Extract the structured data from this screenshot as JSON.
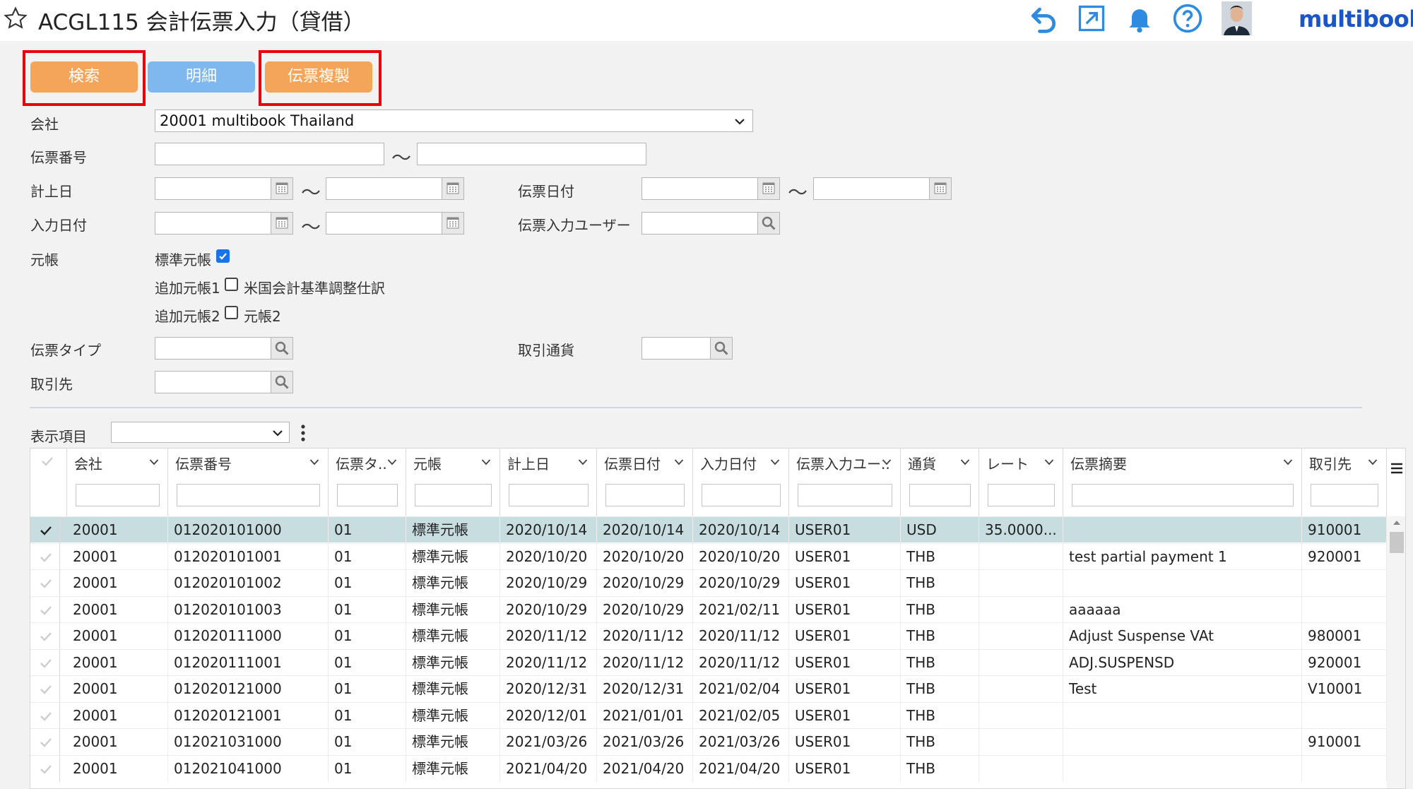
{
  "header": {
    "title": "ACGL115 会計伝票入力（貸借）",
    "logo": "multibook",
    "icons": [
      "star-icon",
      "undo-icon",
      "external-link-icon",
      "bell-icon",
      "help-icon",
      "avatar"
    ]
  },
  "toolbar": {
    "search_label": "検索",
    "detail_label": "明細",
    "copy_label": "伝票複製"
  },
  "form": {
    "company_label": "会社",
    "company_value": "20001 multibook Thailand",
    "voucher_no_label": "伝票番号",
    "posting_date_label": "計上日",
    "voucher_date_label": "伝票日付",
    "input_date_label": "入力日付",
    "input_user_label": "伝票入力ユーザー",
    "ledger_label": "元帳",
    "ledger_standard_label": "標準元帳",
    "ledger_add1_label": "追加元帳1",
    "ledger_add1_option": "米国会計基準調整仕訳",
    "ledger_add2_label": "追加元帳2",
    "ledger_add2_option": "元帳2",
    "voucher_type_label": "伝票タイプ",
    "currency_label": "取引通貨",
    "partner_label": "取引先",
    "range_sep": "〜"
  },
  "display": {
    "label": "表示項目"
  },
  "colors": {
    "orange": "#f5a55a",
    "blue": "#7fb7ef",
    "highlight": "#e8000b",
    "brand": "#1c56c6",
    "selected_row": "#c8dde0"
  },
  "grid": {
    "columns": [
      "会社",
      "伝票番号",
      "伝票タ..",
      "元帳",
      "計上日",
      "伝票日付",
      "入力日付",
      "伝票入力ユー..",
      "通貨",
      "レート",
      "伝票摘要",
      "取引先"
    ],
    "rows": [
      [
        "20001",
        "012020101000",
        "01",
        "標準元帳",
        "2020/10/14",
        "2020/10/14",
        "2020/10/14",
        "USER01",
        "USD",
        "35.0000...",
        "",
        "910001"
      ],
      [
        "20001",
        "012020101001",
        "01",
        "標準元帳",
        "2020/10/20",
        "2020/10/20",
        "2020/10/20",
        "USER01",
        "THB",
        "",
        "test partial payment 1",
        "920001"
      ],
      [
        "20001",
        "012020101002",
        "01",
        "標準元帳",
        "2020/10/29",
        "2020/10/29",
        "2020/10/29",
        "USER01",
        "THB",
        "",
        "",
        ""
      ],
      [
        "20001",
        "012020101003",
        "01",
        "標準元帳",
        "2020/10/29",
        "2020/10/29",
        "2021/02/11",
        "USER01",
        "THB",
        "",
        "aaaaaa",
        ""
      ],
      [
        "20001",
        "012020111000",
        "01",
        "標準元帳",
        "2020/11/12",
        "2020/11/12",
        "2020/11/12",
        "USER01",
        "THB",
        "",
        "Adjust Suspense VAt",
        "980001"
      ],
      [
        "20001",
        "012020111001",
        "01",
        "標準元帳",
        "2020/11/12",
        "2020/11/12",
        "2020/11/12",
        "USER01",
        "THB",
        "",
        "ADJ.SUSPENSD",
        "920001"
      ],
      [
        "20001",
        "012020121000",
        "01",
        "標準元帳",
        "2020/12/31",
        "2020/12/31",
        "2021/02/04",
        "USER01",
        "THB",
        "",
        "Test",
        "V10001"
      ],
      [
        "20001",
        "012020121001",
        "01",
        "標準元帳",
        "2020/12/01",
        "2021/01/01",
        "2021/02/05",
        "USER01",
        "THB",
        "",
        "",
        ""
      ],
      [
        "20001",
        "012021031000",
        "01",
        "標準元帳",
        "2021/03/26",
        "2021/03/26",
        "2021/03/26",
        "USER01",
        "THB",
        "",
        "",
        "910001"
      ],
      [
        "20001",
        "012021041000",
        "01",
        "標準元帳",
        "2021/04/20",
        "2021/04/20",
        "2021/04/20",
        "USER01",
        "THB",
        "",
        "",
        ""
      ]
    ]
  }
}
